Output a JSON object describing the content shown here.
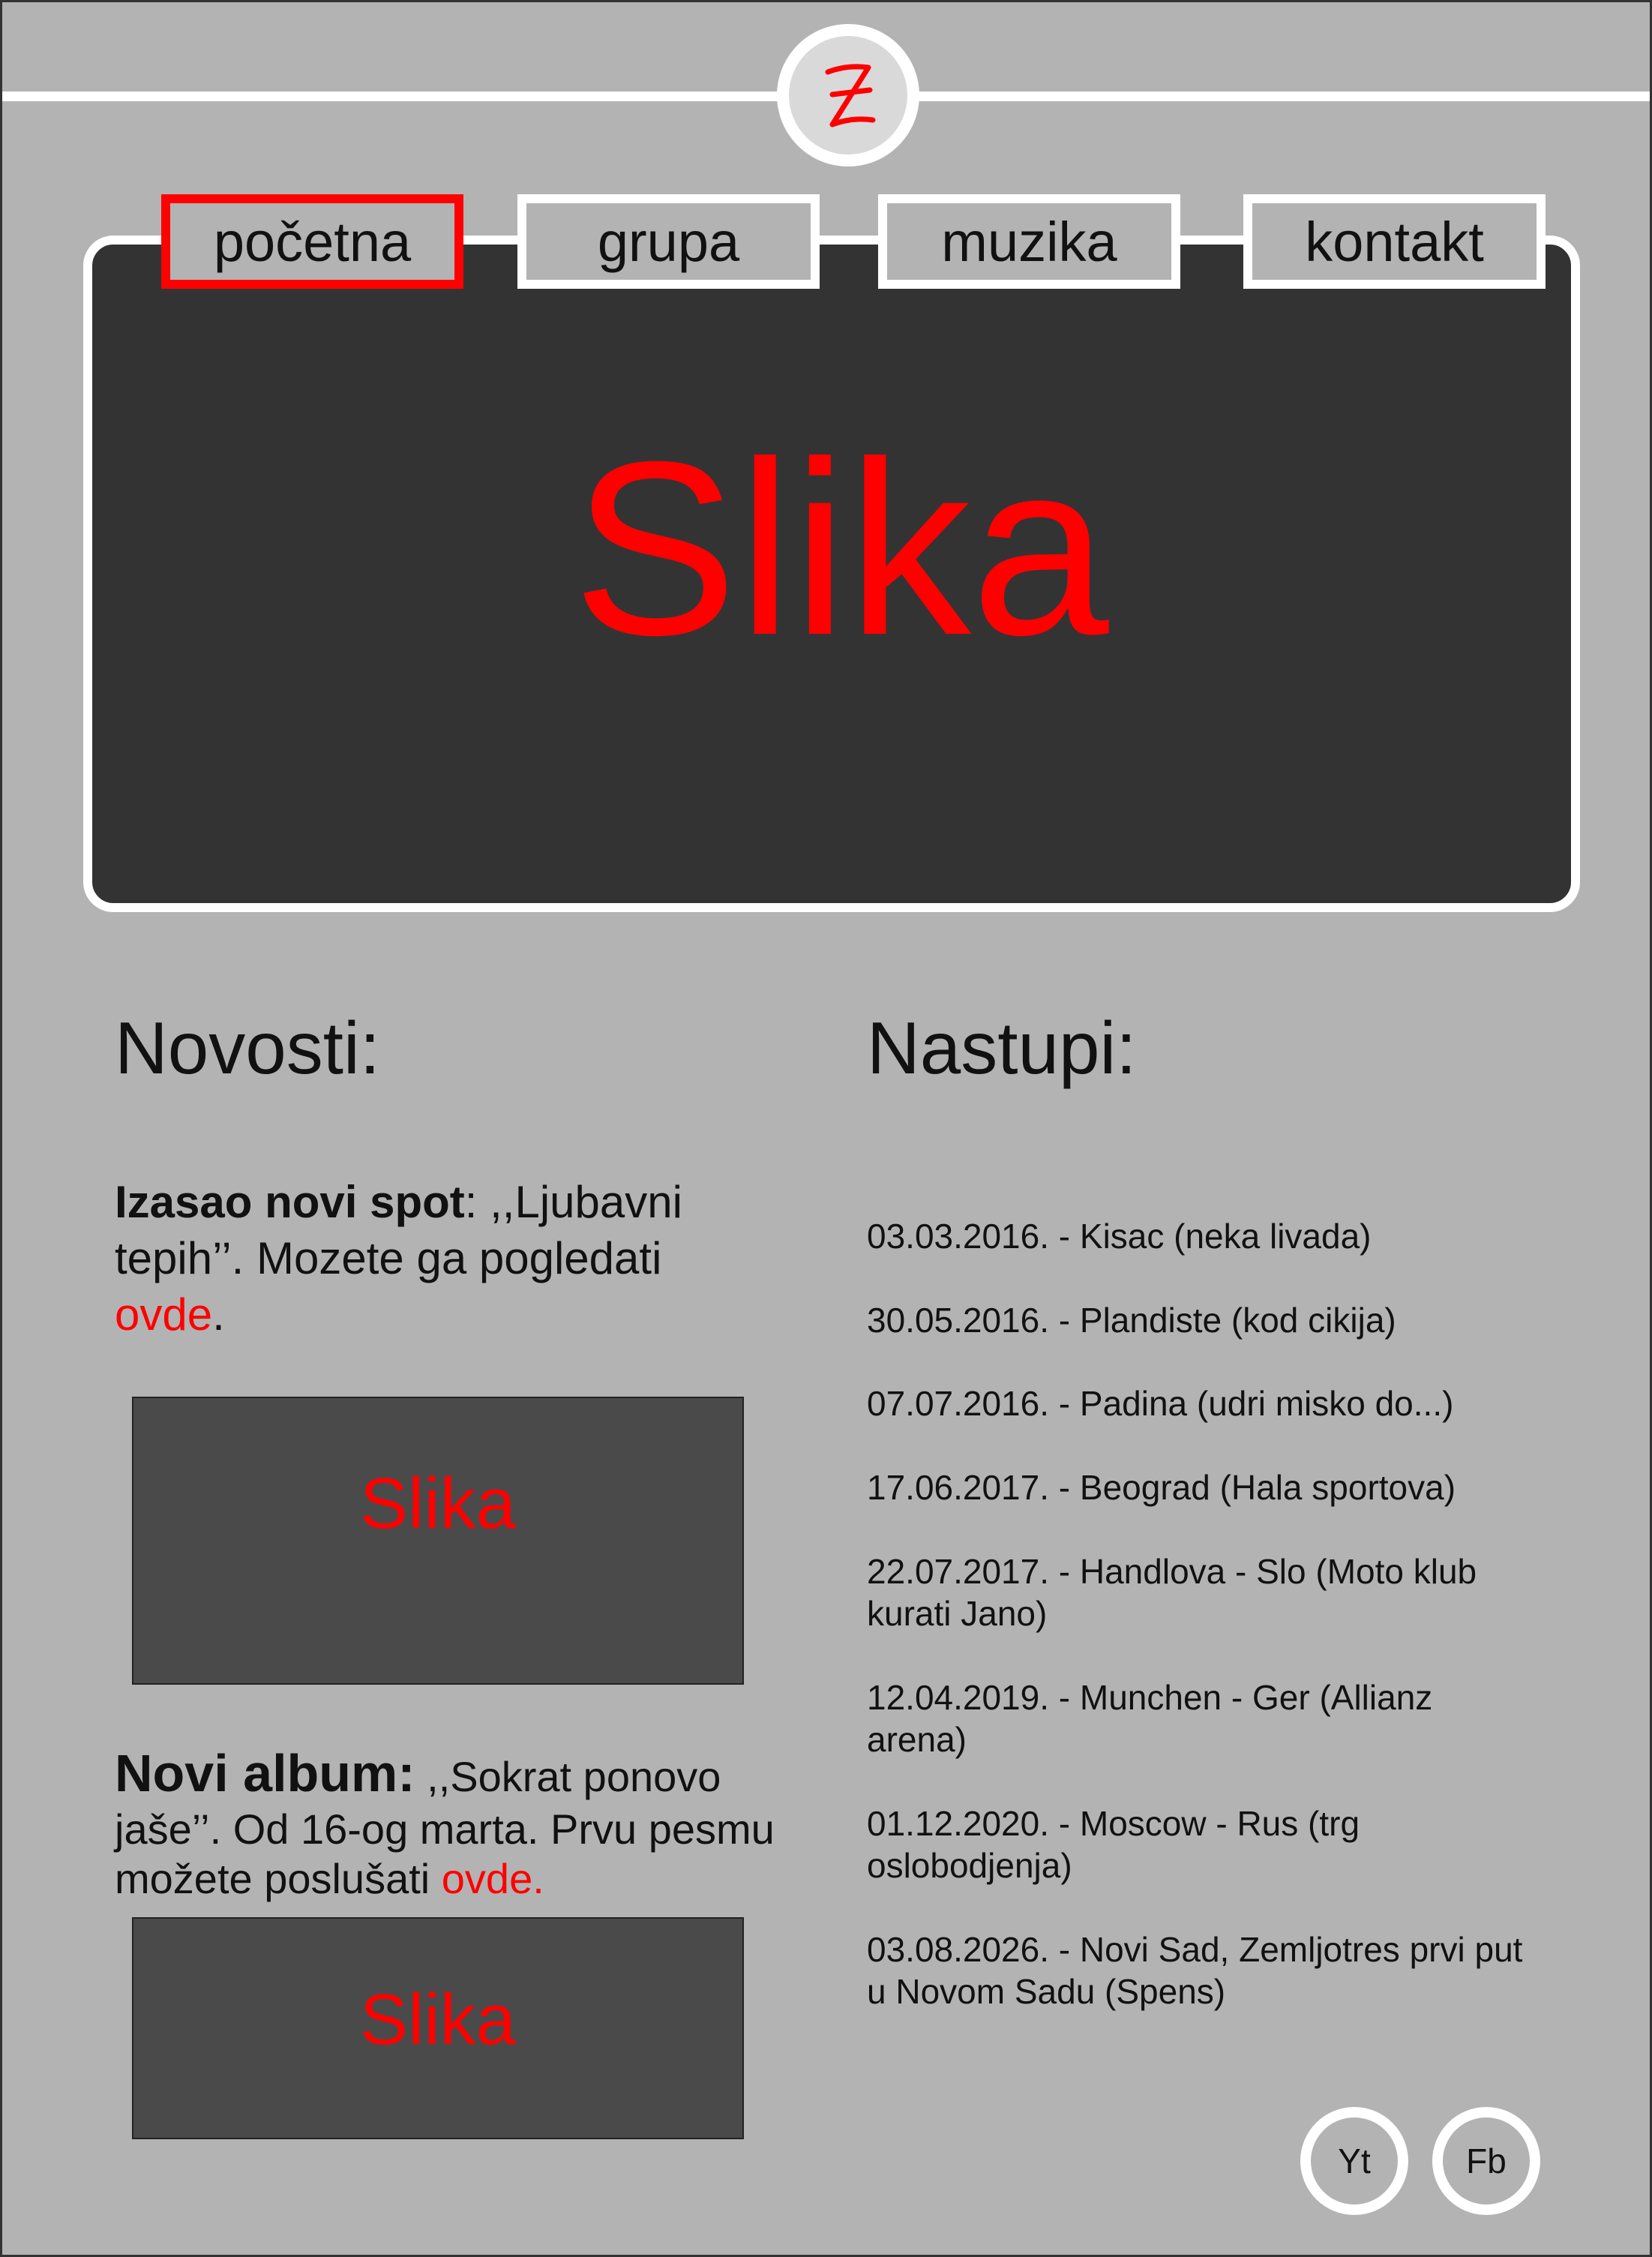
{
  "colors": {
    "accent": "#ff0000",
    "background": "#b3b3b3",
    "panel": "#333333",
    "image_placeholder": "#4a4a4a"
  },
  "logo": {
    "icon": "z-logo-icon"
  },
  "nav": {
    "tabs": [
      {
        "label": "početna",
        "active": true
      },
      {
        "label": "grupa",
        "active": false
      },
      {
        "label": "muzika",
        "active": false
      },
      {
        "label": "kontakt",
        "active": false
      }
    ]
  },
  "hero": {
    "placeholder": "Slika"
  },
  "news": {
    "title": "Novosti:",
    "items": [
      {
        "heading": "Izasao novi spot",
        "text": ": ,,Ljubavni tepih’’. Mozete ga pogledati ",
        "link": "ovde",
        "after": ".",
        "image": "Slika"
      },
      {
        "heading": "Novi album:",
        "text": " ,,Sokrat ponovo jaše’’. Od 16-og marta. Prvu pesmu možete poslušati ",
        "link": "ovde.",
        "image": "Slika"
      }
    ]
  },
  "gigs": {
    "title": "Nastupi:",
    "items": [
      "03.03.2016. - Kisac (neka livada)",
      "30.05.2016. - Plandiste (kod cikija)",
      "07.07.2016. - Padina (udri misko do...)",
      "17.06.2017. - Beograd (Hala sportova)",
      "22.07.2017. - Handlova - Slo (Moto klub kurati Jano)",
      "12.04.2019. - Munchen - Ger (Allianz arena)",
      "01.12.2020. - Moscow - Rus (trg oslobodjenja)",
      "03.08.2026. - Novi Sad, Zemljotres prvi put u Novom Sadu (Spens)"
    ]
  },
  "social": {
    "youtube": "Yt",
    "facebook": "Fb"
  }
}
